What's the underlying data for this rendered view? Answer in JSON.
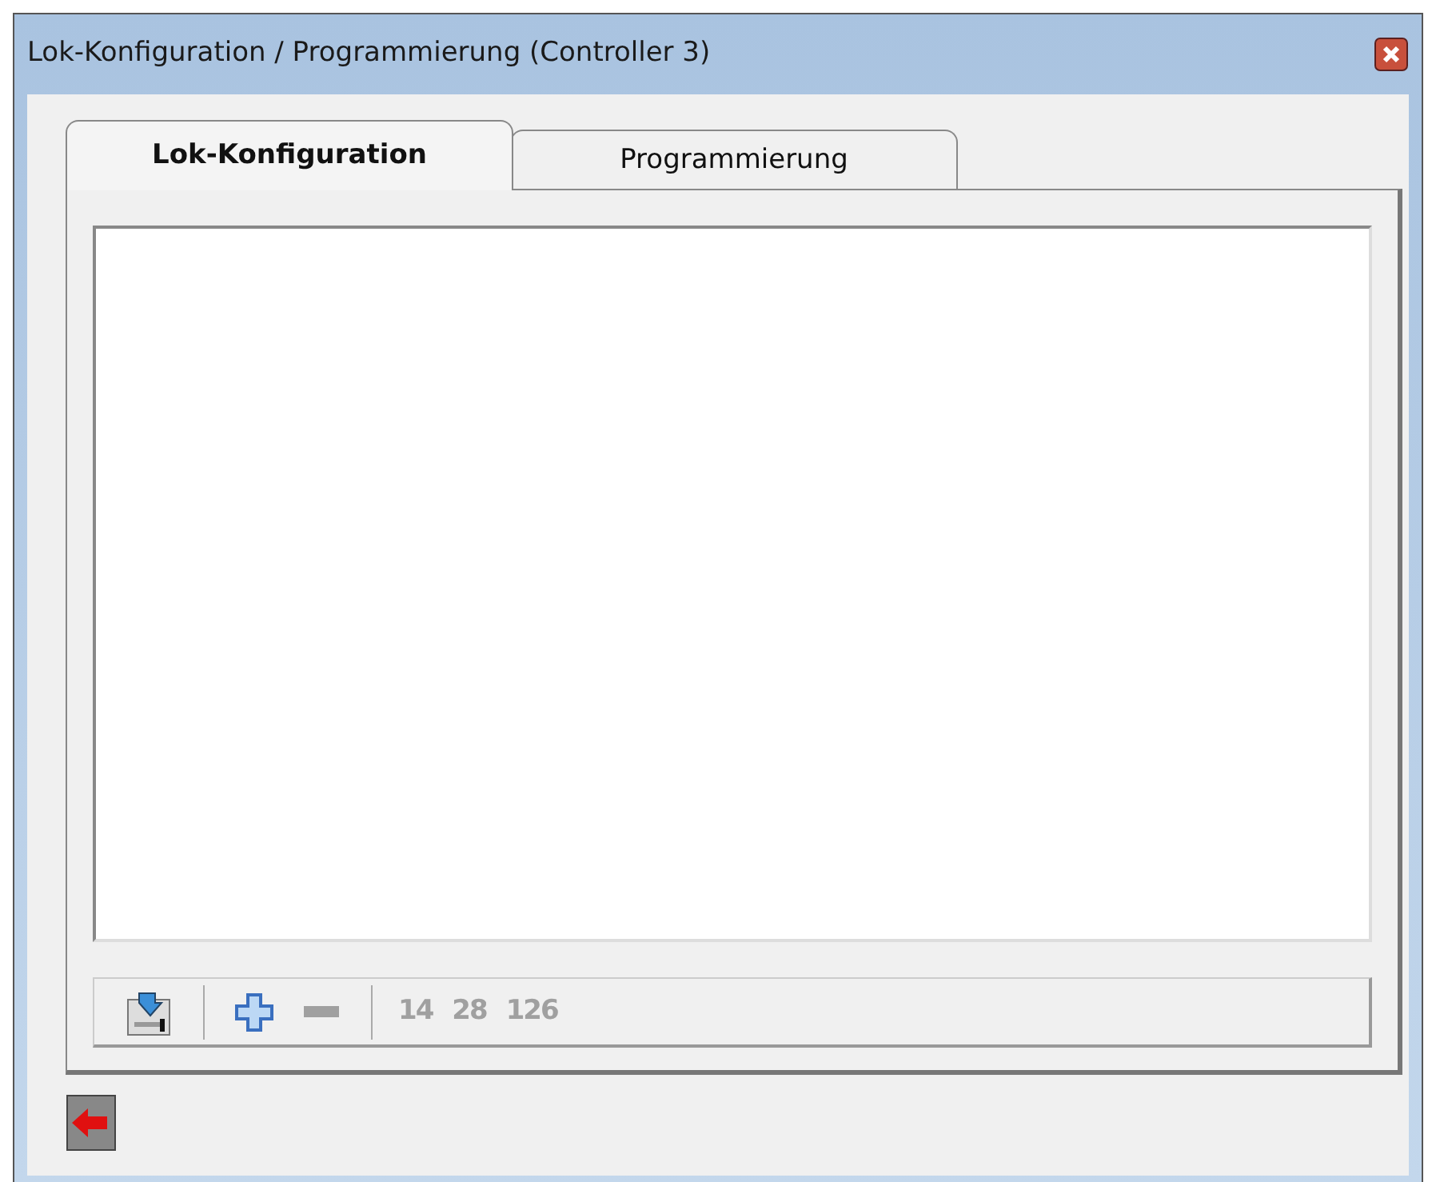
{
  "window": {
    "title": "Lok-Konfiguration / Programmierung (Controller 3)"
  },
  "tabs": [
    {
      "label": "Lok-Konfiguration",
      "selected": true
    },
    {
      "label": "Programmierung",
      "selected": false
    }
  ],
  "toolbar": [
    {
      "kind": "import",
      "disabled": false
    },
    {
      "kind": "separator"
    },
    {
      "kind": "add",
      "disabled": false
    },
    {
      "kind": "remove",
      "disabled": true
    },
    {
      "kind": "separator"
    },
    {
      "kind": "text",
      "label": "14",
      "disabled": true
    },
    {
      "kind": "text",
      "label": "28",
      "disabled": true
    },
    {
      "kind": "text",
      "label": "126",
      "disabled": true
    }
  ]
}
